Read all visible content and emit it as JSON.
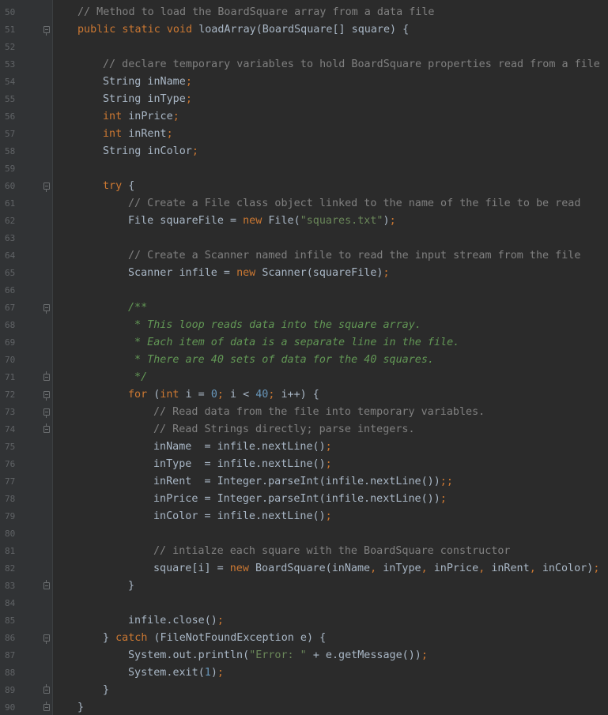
{
  "editor": {
    "theme_colors": {
      "background": "#2b2b2b",
      "gutter": "#313335",
      "line_number": "#606366",
      "plain": "#a9b7c6",
      "keyword": "#cc7832",
      "comment": "#808080",
      "doc_comment": "#629755",
      "string": "#6a8759",
      "number": "#6897bb"
    },
    "lines": [
      {
        "number": "50",
        "fold": "",
        "indent": 1,
        "tokens": [
          [
            "c-com",
            "// Method to load the BoardSquare array from a data file"
          ]
        ]
      },
      {
        "number": "51",
        "fold": "open",
        "indent": 1,
        "tokens": [
          [
            "c-kw",
            "public static void "
          ],
          [
            "c-txt",
            "loadArray(BoardSquare[] square) {"
          ]
        ]
      },
      {
        "number": "52",
        "fold": "",
        "indent": 0,
        "tokens": []
      },
      {
        "number": "53",
        "fold": "",
        "indent": 2,
        "tokens": [
          [
            "c-com",
            "// declare temporary variables to hold BoardSquare properties read from a file"
          ]
        ]
      },
      {
        "number": "54",
        "fold": "",
        "indent": 2,
        "tokens": [
          [
            "c-txt",
            "String inName"
          ],
          [
            "c-kw",
            ";"
          ]
        ]
      },
      {
        "number": "55",
        "fold": "",
        "indent": 2,
        "tokens": [
          [
            "c-txt",
            "String inType"
          ],
          [
            "c-kw",
            ";"
          ]
        ]
      },
      {
        "number": "56",
        "fold": "",
        "indent": 2,
        "tokens": [
          [
            "c-kw",
            "int "
          ],
          [
            "c-txt",
            "inPrice"
          ],
          [
            "c-kw",
            ";"
          ]
        ]
      },
      {
        "number": "57",
        "fold": "",
        "indent": 2,
        "tokens": [
          [
            "c-kw",
            "int "
          ],
          [
            "c-txt",
            "inRent"
          ],
          [
            "c-kw",
            ";"
          ]
        ]
      },
      {
        "number": "58",
        "fold": "",
        "indent": 2,
        "tokens": [
          [
            "c-txt",
            "String inColor"
          ],
          [
            "c-kw",
            ";"
          ]
        ]
      },
      {
        "number": "59",
        "fold": "",
        "indent": 0,
        "tokens": []
      },
      {
        "number": "60",
        "fold": "open",
        "indent": 2,
        "tokens": [
          [
            "c-kw",
            "try "
          ],
          [
            "c-txt",
            "{"
          ]
        ]
      },
      {
        "number": "61",
        "fold": "",
        "indent": 3,
        "tokens": [
          [
            "c-com",
            "// Create a File class object linked to the name of the file to be read"
          ]
        ]
      },
      {
        "number": "62",
        "fold": "",
        "indent": 3,
        "tokens": [
          [
            "c-txt",
            "File squareFile = "
          ],
          [
            "c-kw",
            "new "
          ],
          [
            "c-txt",
            "File("
          ],
          [
            "c-str",
            "\"squares.txt\""
          ],
          [
            "c-txt",
            ")"
          ],
          [
            "c-kw",
            ";"
          ]
        ]
      },
      {
        "number": "63",
        "fold": "",
        "indent": 0,
        "tokens": []
      },
      {
        "number": "64",
        "fold": "",
        "indent": 3,
        "tokens": [
          [
            "c-com",
            "// Create a Scanner named infile to read the input stream from the file"
          ]
        ]
      },
      {
        "number": "65",
        "fold": "",
        "indent": 3,
        "tokens": [
          [
            "c-txt",
            "Scanner infile = "
          ],
          [
            "c-kw",
            "new "
          ],
          [
            "c-txt",
            "Scanner(squareFile)"
          ],
          [
            "c-kw",
            ";"
          ]
        ]
      },
      {
        "number": "66",
        "fold": "",
        "indent": 0,
        "tokens": []
      },
      {
        "number": "67",
        "fold": "open",
        "indent": 3,
        "tokens": [
          [
            "c-doc",
            "/**"
          ]
        ]
      },
      {
        "number": "68",
        "fold": "",
        "indent": 3,
        "tokens": [
          [
            "c-doc",
            " * This loop reads data into the square array."
          ]
        ]
      },
      {
        "number": "69",
        "fold": "",
        "indent": 3,
        "tokens": [
          [
            "c-doc",
            " * Each item of data is a separate line in the file."
          ]
        ]
      },
      {
        "number": "70",
        "fold": "",
        "indent": 3,
        "tokens": [
          [
            "c-doc",
            " * There are 40 sets of data for the 40 squares."
          ]
        ]
      },
      {
        "number": "71",
        "fold": "close",
        "indent": 3,
        "tokens": [
          [
            "c-doc",
            " */"
          ]
        ]
      },
      {
        "number": "72",
        "fold": "open",
        "indent": 3,
        "tokens": [
          [
            "c-kw",
            "for "
          ],
          [
            "c-txt",
            "("
          ],
          [
            "c-kw",
            "int "
          ],
          [
            "c-txt",
            "i = "
          ],
          [
            "c-num",
            "0"
          ],
          [
            "c-kw",
            "; "
          ],
          [
            "c-txt",
            "i < "
          ],
          [
            "c-num",
            "40"
          ],
          [
            "c-kw",
            "; "
          ],
          [
            "c-txt",
            "i++) {"
          ]
        ]
      },
      {
        "number": "73",
        "fold": "open",
        "indent": 4,
        "tokens": [
          [
            "c-com",
            "// Read data from the file into temporary variables."
          ]
        ]
      },
      {
        "number": "74",
        "fold": "close",
        "indent": 4,
        "tokens": [
          [
            "c-com",
            "// Read Strings directly; parse integers."
          ]
        ]
      },
      {
        "number": "75",
        "fold": "",
        "indent": 4,
        "tokens": [
          [
            "c-txt",
            "inName  = infile.nextLine()"
          ],
          [
            "c-kw",
            ";"
          ]
        ]
      },
      {
        "number": "76",
        "fold": "",
        "indent": 4,
        "tokens": [
          [
            "c-txt",
            "inType  = infile.nextLine()"
          ],
          [
            "c-kw",
            ";"
          ]
        ]
      },
      {
        "number": "77",
        "fold": "",
        "indent": 4,
        "tokens": [
          [
            "c-txt",
            "inRent  = Integer.parseInt(infile.nextLine())"
          ],
          [
            "c-kw",
            ";;"
          ]
        ]
      },
      {
        "number": "78",
        "fold": "",
        "indent": 4,
        "tokens": [
          [
            "c-txt",
            "inPrice = Integer.parseInt(infile.nextLine())"
          ],
          [
            "c-kw",
            ";"
          ]
        ]
      },
      {
        "number": "79",
        "fold": "",
        "indent": 4,
        "tokens": [
          [
            "c-txt",
            "inColor = infile.nextLine()"
          ],
          [
            "c-kw",
            ";"
          ]
        ]
      },
      {
        "number": "80",
        "fold": "",
        "indent": 0,
        "tokens": []
      },
      {
        "number": "81",
        "fold": "",
        "indent": 4,
        "tokens": [
          [
            "c-com",
            "// intialze each square with the BoardSquare constructor"
          ]
        ]
      },
      {
        "number": "82",
        "fold": "",
        "indent": 4,
        "tokens": [
          [
            "c-txt",
            "square[i] = "
          ],
          [
            "c-kw",
            "new "
          ],
          [
            "c-txt",
            "BoardSquare(inName"
          ],
          [
            "c-kw",
            ", "
          ],
          [
            "c-txt",
            "inType"
          ],
          [
            "c-kw",
            ", "
          ],
          [
            "c-txt",
            "inPrice"
          ],
          [
            "c-kw",
            ", "
          ],
          [
            "c-txt",
            "inRent"
          ],
          [
            "c-kw",
            ", "
          ],
          [
            "c-txt",
            "inColor)"
          ],
          [
            "c-kw",
            ";"
          ]
        ]
      },
      {
        "number": "83",
        "fold": "close",
        "indent": 3,
        "tokens": [
          [
            "c-txt",
            "}"
          ]
        ]
      },
      {
        "number": "84",
        "fold": "",
        "indent": 0,
        "tokens": []
      },
      {
        "number": "85",
        "fold": "",
        "indent": 3,
        "tokens": [
          [
            "c-txt",
            "infile.close()"
          ],
          [
            "c-kw",
            ";"
          ]
        ]
      },
      {
        "number": "86",
        "fold": "open",
        "indent": 2,
        "tokens": [
          [
            "c-txt",
            "} "
          ],
          [
            "c-kw",
            "catch "
          ],
          [
            "c-txt",
            "(FileNotFoundException e) {"
          ]
        ]
      },
      {
        "number": "87",
        "fold": "",
        "indent": 3,
        "tokens": [
          [
            "c-txt",
            "System."
          ],
          [
            "c-txt",
            "out"
          ],
          [
            "c-txt",
            ".println("
          ],
          [
            "c-str",
            "\"Error: \" "
          ],
          [
            "c-txt",
            "+ e.getMessage())"
          ],
          [
            "c-kw",
            ";"
          ]
        ]
      },
      {
        "number": "88",
        "fold": "",
        "indent": 3,
        "tokens": [
          [
            "c-txt",
            "System."
          ],
          [
            "c-txt",
            "exit"
          ],
          [
            "c-txt",
            "("
          ],
          [
            "c-num",
            "1"
          ],
          [
            "c-txt",
            ")"
          ],
          [
            "c-kw",
            ";"
          ]
        ]
      },
      {
        "number": "89",
        "fold": "close",
        "indent": 2,
        "tokens": [
          [
            "c-txt",
            "}"
          ]
        ]
      },
      {
        "number": "90",
        "fold": "close",
        "indent": 1,
        "tokens": [
          [
            "c-txt",
            "}"
          ]
        ]
      }
    ]
  }
}
